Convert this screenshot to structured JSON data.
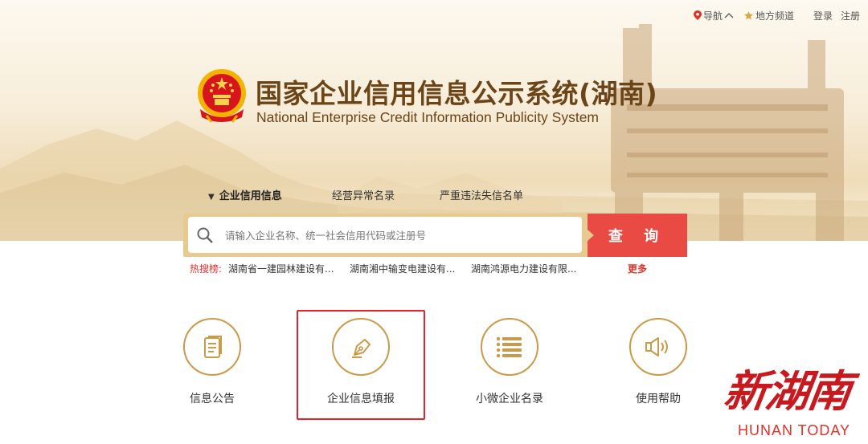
{
  "header": {
    "nav_label": "导航",
    "region_label": "地方频道",
    "login_label": "登录",
    "register_label": "注册"
  },
  "logo": {
    "title_cn": "国家企业信用信息公示系统(湖南)",
    "title_en": "National Enterprise Credit Information Publicity System"
  },
  "tabs": [
    {
      "label": "企业信用信息",
      "active": true
    },
    {
      "label": "经营异常名录",
      "active": false
    },
    {
      "label": "严重违法失信名单",
      "active": false
    }
  ],
  "search": {
    "placeholder": "请输入企业名称、统一社会信用代码或注册号",
    "button_label": "查 询"
  },
  "hot_search": {
    "label": "热搜榜:",
    "items": [
      "湖南省一建园林建设有...",
      "湖南湘中输变电建设有...",
      "湖南鸿源电力建设有限..."
    ],
    "more_label": "更多"
  },
  "features": [
    {
      "label": "信息公告",
      "icon": "document-icon"
    },
    {
      "label": "企业信息填报",
      "icon": "pen-nib-icon",
      "highlighted": true
    },
    {
      "label": "小微企业名录",
      "icon": "list-icon"
    },
    {
      "label": "使用帮助",
      "icon": "speaker-icon"
    }
  ],
  "watermark": {
    "name_cn": "新湖南",
    "name_en": "HUNAN TODAY"
  },
  "colors": {
    "accent_red": "#e94b44",
    "gold": "#c99a4a",
    "title_brown": "#6b4418",
    "highlight_border": "#e5232a"
  }
}
